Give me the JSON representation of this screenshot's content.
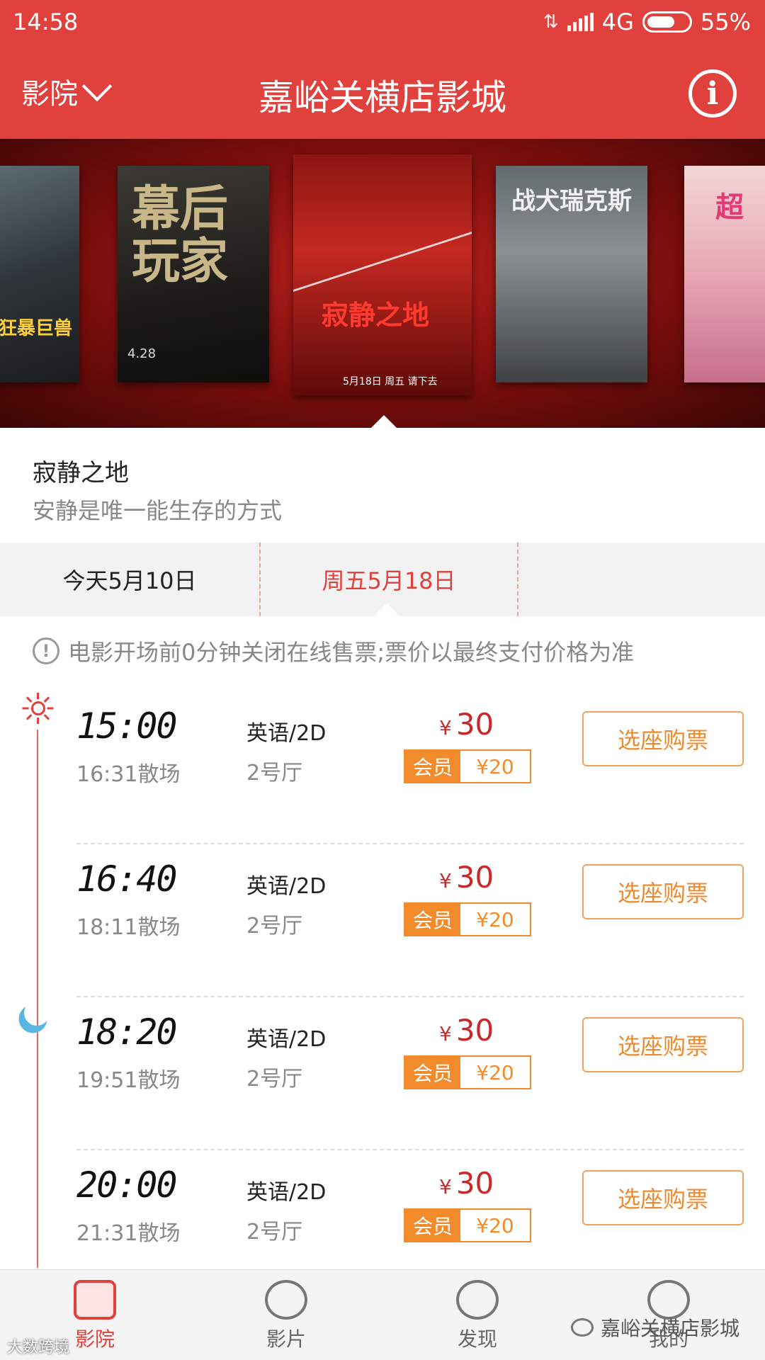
{
  "status": {
    "time": "14:58",
    "network": "4G",
    "battery": "55%"
  },
  "header": {
    "left_label": "影院",
    "title": "嘉峪关横店影城",
    "info_icon": "i"
  },
  "posters": [
    {
      "title": "狂暴巨兽"
    },
    {
      "title": "幕后玩家",
      "date": "4.28"
    },
    {
      "title": "寂静之地",
      "date": "5月18日 周五 请下去"
    },
    {
      "title": "战犬瑞克斯"
    },
    {
      "title": "超"
    }
  ],
  "movie": {
    "title": "寂静之地",
    "tagline": "安静是唯一能生存的方式"
  },
  "dates": [
    {
      "label": "今天5月10日"
    },
    {
      "label": "周五5月18日"
    }
  ],
  "notice": "电影开场前0分钟关闭在线售票;票价以最终支付价格为准",
  "showtimes": [
    {
      "start": "15:00",
      "end": "16:31散场",
      "lang": "英语/2D",
      "hall": "2号厅",
      "currency": "¥",
      "price": "30",
      "member_label": "会员",
      "member_price": "¥20",
      "buy_label": "选座购票"
    },
    {
      "start": "16:40",
      "end": "18:11散场",
      "lang": "英语/2D",
      "hall": "2号厅",
      "currency": "¥",
      "price": "30",
      "member_label": "会员",
      "member_price": "¥20",
      "buy_label": "选座购票"
    },
    {
      "start": "18:20",
      "end": "19:51散场",
      "lang": "英语/2D",
      "hall": "2号厅",
      "currency": "¥",
      "price": "30",
      "member_label": "会员",
      "member_price": "¥20",
      "buy_label": "选座购票"
    },
    {
      "start": "20:00",
      "end": "21:31散场",
      "lang": "英语/2D",
      "hall": "2号厅",
      "currency": "¥",
      "price": "30",
      "member_label": "会员",
      "member_price": "¥20",
      "buy_label": "选座购票"
    }
  ],
  "bottom_nav": [
    {
      "label": "影院",
      "active": true
    },
    {
      "label": "影片"
    },
    {
      "label": "发现"
    },
    {
      "label": "我的"
    }
  ],
  "watermark": {
    "text": "嘉峪关横店影城",
    "left_text": "大数跨境"
  },
  "colors": {
    "brand": "#e0413d",
    "member": "#f28b2b",
    "price": "#c9282a"
  }
}
